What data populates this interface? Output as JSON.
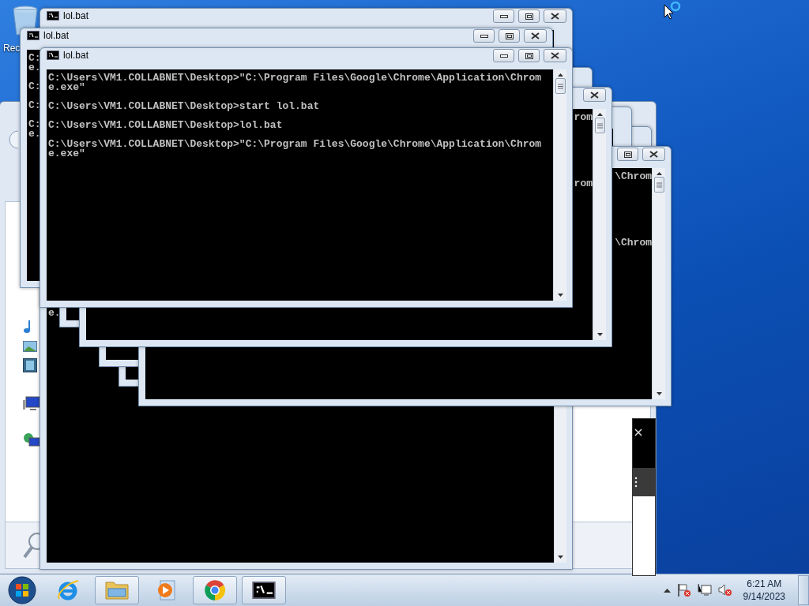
{
  "desktop": {
    "icons": [
      {
        "label": "Rec"
      }
    ]
  },
  "console_windows": [
    {
      "kind": "fragments",
      "title": "lol.bat",
      "fragments": [
        "e."
      ]
    },
    {
      "kind": "frame"
    },
    {
      "kind": "frame"
    },
    {
      "kind": "fragments",
      "fragments": [
        "\\Chrom",
        "\\Chrom"
      ]
    },
    {
      "kind": "frame"
    },
    {
      "kind": "fragments",
      "fragments": [
        "rom",
        "rom"
      ]
    },
    {
      "kind": "fragments",
      "title": "lol.bat",
      "fragments": [
        "C:",
        "e.",
        "C:",
        "C:",
        "C:",
        "e."
      ]
    },
    {
      "kind": "console",
      "title": "lol.bat",
      "entries": [
        [
          "C:\\Users\\VM1.COLLABNET\\Desktop>\"C:\\Program Files\\Google\\Chrome\\Application\\Chrom",
          "e.exe\""
        ],
        [
          "C:\\Users\\VM1.COLLABNET\\Desktop>start lol.bat"
        ],
        [
          "C:\\Users\\VM1.COLLABNET\\Desktop>lol.bat"
        ],
        [
          "C:\\Users\\VM1.COLLABNET\\Desktop>\"C:\\Program Files\\Google\\Chrome\\Application\\Chrom",
          "e.exe\""
        ]
      ]
    }
  ],
  "taskbar": {
    "items": [
      {
        "kind": "ie",
        "running": false
      },
      {
        "kind": "explorer",
        "running": true
      },
      {
        "kind": "media",
        "running": false
      },
      {
        "kind": "chrome",
        "running": true
      },
      {
        "kind": "cmd",
        "running": true
      }
    ],
    "tray": {
      "time": "6:21 AM",
      "date": "9/14/2023"
    }
  }
}
